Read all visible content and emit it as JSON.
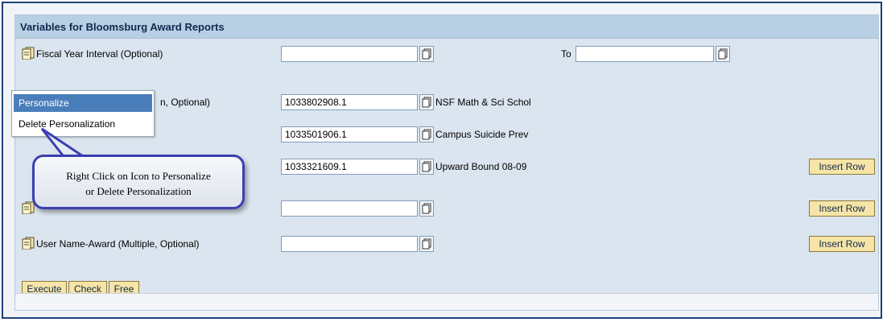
{
  "form": {
    "title": "Variables for Bloomsburg Award Reports",
    "variables": [
      {
        "label": "Fiscal Year Interval (Optional)",
        "value": "",
        "to_label": "To",
        "to_value": ""
      },
      {
        "label": "n, Optional)",
        "rows": [
          {
            "value": "1033802908.1",
            "description": "NSF Math & Sci Schol"
          },
          {
            "value": "1033501906.1",
            "description": "Campus Suicide Prev"
          },
          {
            "value": "1033321609.1",
            "description": "Upward Bound 08-09"
          }
        ],
        "insert_row_label": "Insert Row"
      },
      {
        "label": "",
        "value": "",
        "insert_row_label": "Insert Row"
      },
      {
        "label": "User Name-Award (Multiple, Optional)",
        "value": "",
        "insert_row_label": "Insert Row"
      }
    ],
    "buttons": {
      "execute": "Execute",
      "check": "Check",
      "free": "Free"
    }
  },
  "context_menu": {
    "items": [
      "Personalize",
      "Delete Personalization"
    ],
    "active_index": 0
  },
  "callout": {
    "line1": "Right Click on Icon to Personalize",
    "line2": "or Delete Personalization"
  },
  "colors": {
    "frame_border": "#1f3f7a",
    "panel_bg": "#dbe5ef",
    "header_bg": "#b8cfe4",
    "button_bg": "#f7e4a7",
    "menu_highlight": "#4a7ebb",
    "callout_border": "#3b3fb0"
  },
  "icons": {
    "variable_icon": "variable-multi-icon",
    "value_help_icon": "value-help-icon"
  }
}
